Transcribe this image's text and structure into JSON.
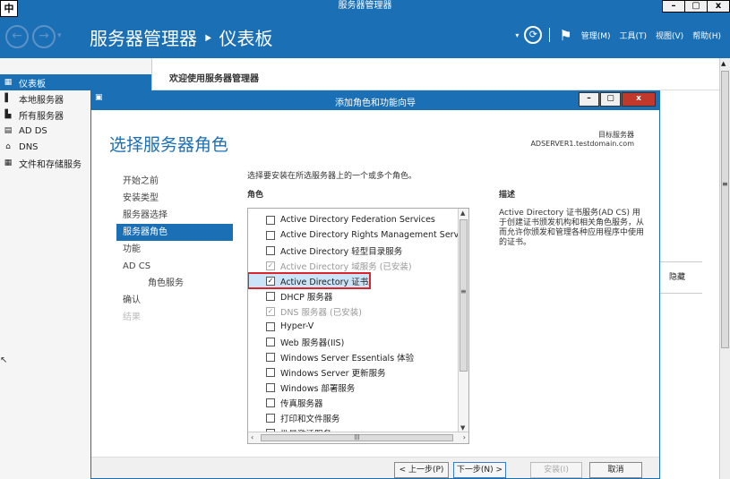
{
  "window": {
    "title": "服务器管理器",
    "ime": "中",
    "controls": [
      "–",
      "▢",
      "x"
    ]
  },
  "header": {
    "title": "服务器管理器 ‣ 仪表板",
    "back_glyph": "←",
    "forward_glyph": "→",
    "dropdown_glyph": "▾",
    "refresh_glyph": "⟳",
    "flag_glyph": "⚑",
    "menus": [
      "管理(M)",
      "工具(T)",
      "视图(V)",
      "帮助(H)"
    ]
  },
  "sidebar": {
    "items": [
      {
        "label": "仪表板",
        "icon": "▦",
        "active": true
      },
      {
        "label": "本地服务器",
        "icon": "▌"
      },
      {
        "label": "所有服务器",
        "icon": "▙"
      },
      {
        "label": "AD DS",
        "icon": "▤"
      },
      {
        "label": "DNS",
        "icon": "⌂"
      },
      {
        "label": "文件和存储服务",
        "icon": "▦"
      }
    ],
    "pointer_glyph": "↖"
  },
  "main": {
    "welcome": "欢迎使用服务器管理器",
    "hide_label": "隐藏"
  },
  "wizard": {
    "title": "添加角色和功能向导",
    "heading": "选择服务器角色",
    "destination_label": "目标服务器",
    "destination_server": "ADSERVER1.testdomain.com",
    "instruction": "选择要安装在所选服务器上的一个或多个角色。",
    "roles_label": "角色",
    "description_label": "描述",
    "description_text": "Active Directory 证书服务(AD CS) 用于创建证书颁发机构和相关角色服务，从而允许你颁发和管理各种应用程序中使用的证书。",
    "nav": [
      {
        "label": "开始之前",
        "state": "normal"
      },
      {
        "label": "安装类型",
        "state": "normal"
      },
      {
        "label": "服务器选择",
        "state": "normal"
      },
      {
        "label": "服务器角色",
        "state": "active"
      },
      {
        "label": "功能",
        "state": "normal"
      },
      {
        "label": "AD CS",
        "state": "normal"
      },
      {
        "label": "角色服务",
        "state": "sub"
      },
      {
        "label": "确认",
        "state": "normal"
      },
      {
        "label": "结果",
        "state": "disabled"
      }
    ],
    "roles": [
      {
        "label": "Active Directory Federation Services",
        "checked": false,
        "state": "normal"
      },
      {
        "label": "Active Directory Rights Management Services",
        "checked": false,
        "state": "normal"
      },
      {
        "label": "Active Directory 轻型目录服务",
        "checked": false,
        "state": "normal"
      },
      {
        "label": "Active Directory 域服务 (已安装)",
        "checked": true,
        "state": "installed"
      },
      {
        "label": "Active Directory 证书服务",
        "checked": true,
        "state": "selected"
      },
      {
        "label": "DHCP 服务器",
        "checked": false,
        "state": "normal"
      },
      {
        "label": "DNS 服务器 (已安装)",
        "checked": true,
        "state": "installed"
      },
      {
        "label": "Hyper-V",
        "checked": false,
        "state": "normal"
      },
      {
        "label": "Web 服务器(IIS)",
        "checked": false,
        "state": "normal"
      },
      {
        "label": "Windows Server Essentials 体验",
        "checked": false,
        "state": "normal"
      },
      {
        "label": "Windows Server 更新服务",
        "checked": false,
        "state": "normal"
      },
      {
        "label": "Windows 部署服务",
        "checked": false,
        "state": "normal"
      },
      {
        "label": "传真服务器",
        "checked": false,
        "state": "normal"
      },
      {
        "label": "打印和文件服务",
        "checked": false,
        "state": "normal"
      },
      {
        "label": "批量激活服务",
        "checked": false,
        "state": "normal"
      }
    ],
    "buttons": {
      "prev": "< 上一步(P)",
      "next": "下一步(N) >",
      "install": "安装(I)",
      "cancel": "取消"
    }
  }
}
